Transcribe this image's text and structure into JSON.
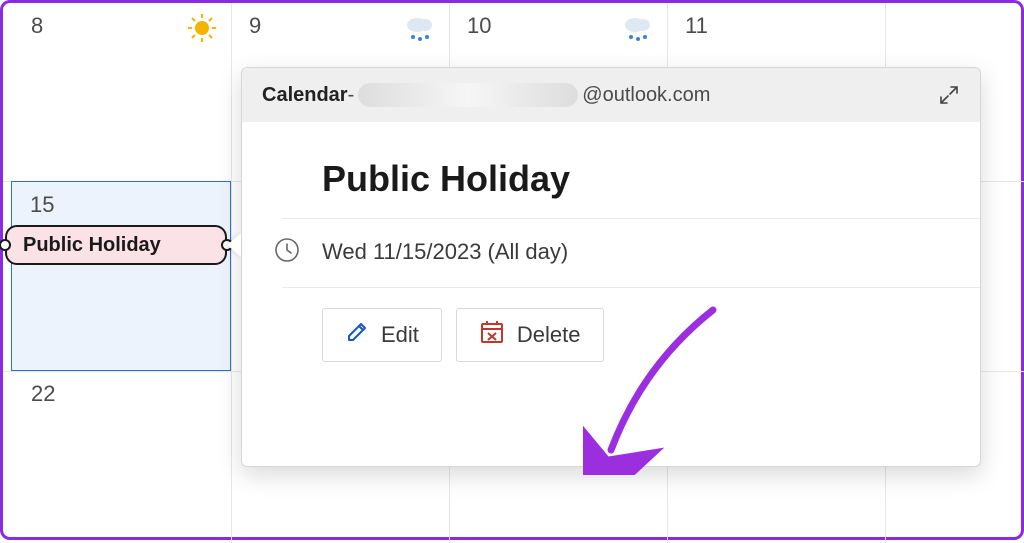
{
  "week1": {
    "d8": "8",
    "d9": "9",
    "d10": "10",
    "d11": "11"
  },
  "week2": {
    "d15": "15"
  },
  "week3": {
    "d22": "22"
  },
  "weather": {
    "d8": "sunny",
    "d9": "rain",
    "d10": "rain"
  },
  "event": {
    "pill_label": "Public Holiday"
  },
  "popup": {
    "source_label": "Calendar",
    "dash": " - ",
    "email_domain": "@outlook.com",
    "title": "Public Holiday",
    "time": "Wed 11/15/2023 (All day)",
    "edit_label": "Edit",
    "delete_label": "Delete"
  },
  "colors": {
    "annotation": "#9b2fe0",
    "edit_icon": "#1658c9",
    "delete_icon": "#c0392b"
  }
}
